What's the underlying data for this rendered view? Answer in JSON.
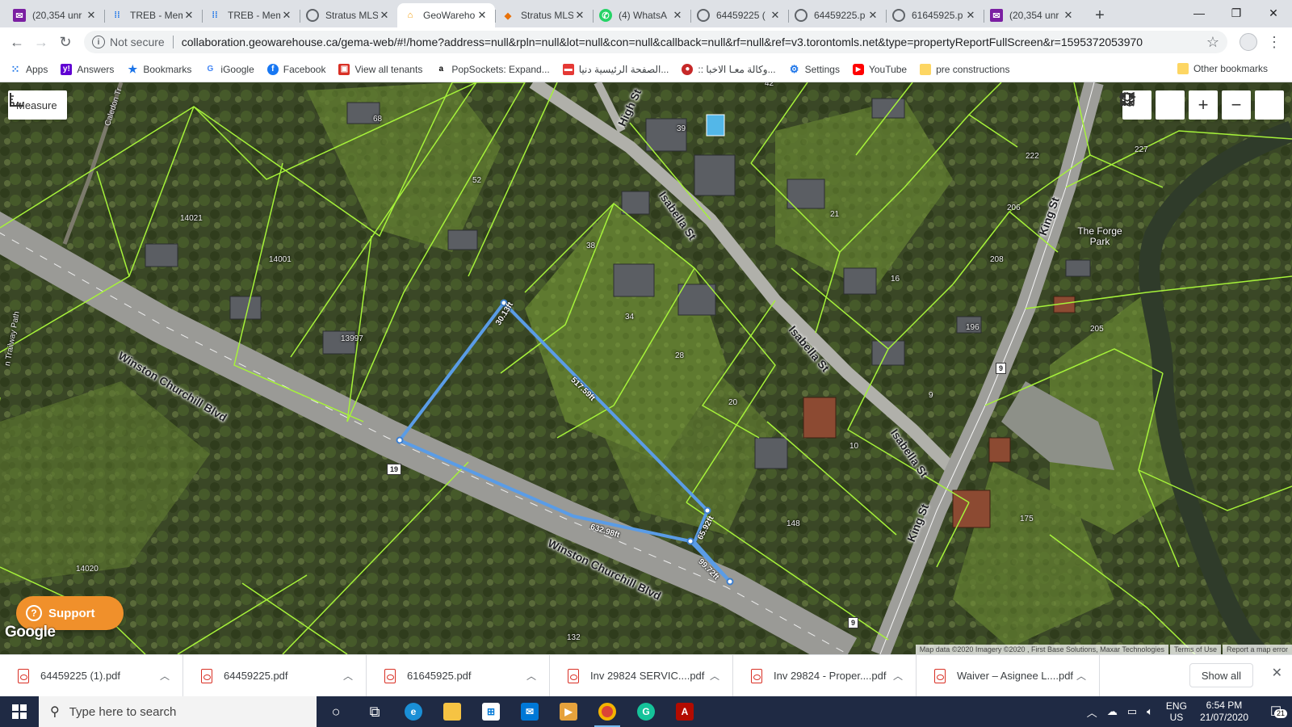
{
  "browser": {
    "tabs": [
      {
        "label": "(20,354 unr",
        "icon": "mail-icon",
        "active": false
      },
      {
        "label": "TREB - Mem",
        "icon": "grid-icon",
        "active": false
      },
      {
        "label": "TREB - Mem",
        "icon": "grid-icon",
        "active": false
      },
      {
        "label": "Stratus MLS",
        "icon": "globe-icon",
        "active": false
      },
      {
        "label": "GeoWareho",
        "icon": "house-icon",
        "active": true
      },
      {
        "label": "Stratus MLS",
        "icon": "cube-icon",
        "active": false
      },
      {
        "label": "(4) WhatsA",
        "icon": "whatsapp-icon",
        "active": false
      },
      {
        "label": "64459225 (",
        "icon": "globe-icon",
        "active": false
      },
      {
        "label": "64459225.p",
        "icon": "globe-icon",
        "active": false
      },
      {
        "label": "61645925.p",
        "icon": "globe-icon",
        "active": false
      },
      {
        "label": "(20,354 unr",
        "icon": "mail-icon",
        "active": false
      }
    ],
    "address_bar": {
      "security_label": "Not secure",
      "url": "collaboration.geowarehouse.ca/gema-web/#!/home?address=null&rpln=null&lot=null&con=null&callback=null&rf=null&ref=v3.torontomls.net&type=propertyReportFullScreen&r=1595372053970"
    },
    "bookmarks": [
      {
        "label": "Apps",
        "icon": "apps-icon"
      },
      {
        "label": "Answers",
        "icon": "yahoo-icon"
      },
      {
        "label": "Bookmarks",
        "icon": "star-icon"
      },
      {
        "label": "iGoogle",
        "icon": "google-icon"
      },
      {
        "label": "Facebook",
        "icon": "facebook-icon"
      },
      {
        "label": "View all tenants",
        "icon": "tenant-icon"
      },
      {
        "label": "PopSockets: Expand...",
        "icon": "amazon-icon"
      },
      {
        "label": "الصفحة الرئيسية دنيا...",
        "icon": "news-icon"
      },
      {
        "label": ":: وكالة معـا الاخبا...",
        "icon": "maan-icon"
      },
      {
        "label": "Settings",
        "icon": "gear-icon"
      },
      {
        "label": "YouTube",
        "icon": "youtube-icon"
      },
      {
        "label": "pre constructions",
        "icon": "folder-icon"
      }
    ],
    "bookmarks_more": "»",
    "other_bookmarks": "Other bookmarks"
  },
  "map": {
    "measure_button": "Measure",
    "support_button": "Support",
    "google_logo": "Google",
    "attribution": {
      "data": "Map data ©2020 Imagery ©2020 , First Base Solutions, Maxar Technologies",
      "terms": "Terms of Use",
      "report": "Report a map error"
    },
    "roads": {
      "winston_upper": "Winston Churchill Blvd",
      "winston_lower": "Winston Churchill Blvd",
      "isabella_1": "Isabella St",
      "isabella_2": "Isabella St",
      "isabella_3": "Isabella St",
      "isabella_4": "Isabella St",
      "high": "High St",
      "king_1": "King St",
      "king_2": "King St",
      "caledon": "Caledon Tr",
      "trailway": "n Trailway Path",
      "park": "The Forge Park"
    },
    "route_shields": {
      "r19_a": "19",
      "r9_a": "9",
      "r9_b": "9"
    },
    "lots": {
      "l68": "68",
      "l52": "52",
      "l14021": "14021",
      "l14001": "14001",
      "l13997": "13997",
      "l42": "42",
      "l39": "39",
      "l38": "38",
      "l34": "34",
      "l28": "28",
      "l20": "20",
      "l21": "21",
      "l16": "16",
      "l9": "9",
      "l10": "10",
      "l148": "148",
      "l14020": "14020",
      "l132": "132",
      "l222": "222",
      "l227": "227",
      "l206": "206",
      "l208": "208",
      "l196": "196",
      "l205": "205",
      "l175": "175"
    },
    "measurements": {
      "m1": "30.13ft",
      "m2": "517.59ft",
      "m3": "632.98ft",
      "m4": "65.92ft",
      "m5": "99.72ft"
    }
  },
  "downloads": {
    "items": [
      {
        "name": "64459225 (1).pdf"
      },
      {
        "name": "64459225.pdf"
      },
      {
        "name": "61645925.pdf"
      },
      {
        "name": "Inv 29824  SERVIC....pdf"
      },
      {
        "name": "Inv 29824 - Proper....pdf"
      },
      {
        "name": "Waiver – Asignee L....pdf"
      }
    ],
    "show_all": "Show all"
  },
  "taskbar": {
    "search_placeholder": "Type here to search",
    "language": {
      "line1": "ENG",
      "line2": "US"
    },
    "clock": {
      "time": "6:54 PM",
      "date": "21/07/2020"
    },
    "notification_count": "21"
  }
}
